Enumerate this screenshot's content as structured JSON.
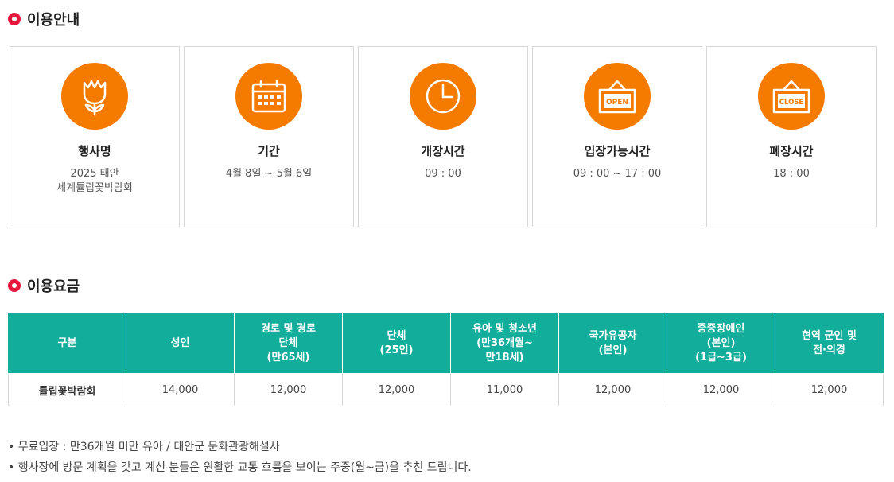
{
  "section1": {
    "title": "이용안내"
  },
  "cards": [
    {
      "icon": "tulip-icon",
      "title": "행사명",
      "value": "2025 태안\n세계튤립꽃박람회"
    },
    {
      "icon": "calendar-icon",
      "title": "기간",
      "value": "4월 8일 ~ 5월 6일"
    },
    {
      "icon": "clock-icon",
      "title": "개장시간",
      "value": "09 : 00"
    },
    {
      "icon": "open-sign-icon",
      "title": "입장가능시간",
      "value": "09 : 00 ~ 17 : 00"
    },
    {
      "icon": "close-sign-icon",
      "title": "폐장시간",
      "value": "18 : 00"
    }
  ],
  "icon_text": {
    "open": "OPEN",
    "close": "CLOSE"
  },
  "section2": {
    "title": "이용요금"
  },
  "fee_table": {
    "headers": [
      [
        "구분"
      ],
      [
        "성인"
      ],
      [
        "경로 및 경로",
        "단체",
        "(만65세)"
      ],
      [
        "단체",
        "(25인)"
      ],
      [
        "유아 및 청소년",
        "(만36개월~",
        "만18세)"
      ],
      [
        "국가유공자",
        "(본인)"
      ],
      [
        "중증장애인",
        "(본인)",
        "(1급~3급)"
      ],
      [
        "현역 군인 및",
        "전·의경"
      ]
    ],
    "rows": [
      [
        "튤립꽃박람회",
        "14,000",
        "12,000",
        "12,000",
        "11,000",
        "12,000",
        "12,000",
        "12,000"
      ]
    ]
  },
  "notes": [
    "• 무료입장 : 만36개월 미만 유아 / 태안군 문화관광해설사",
    "• 행사장에 방문 계획을 갖고 계신 분들은 원활한 교통 흐름을 보이는 주중(월~금)을 추천 드립니다."
  ],
  "colors": {
    "accent": "#f47b00",
    "table_header": "#13ad9b",
    "bullet": "#e8173c"
  }
}
